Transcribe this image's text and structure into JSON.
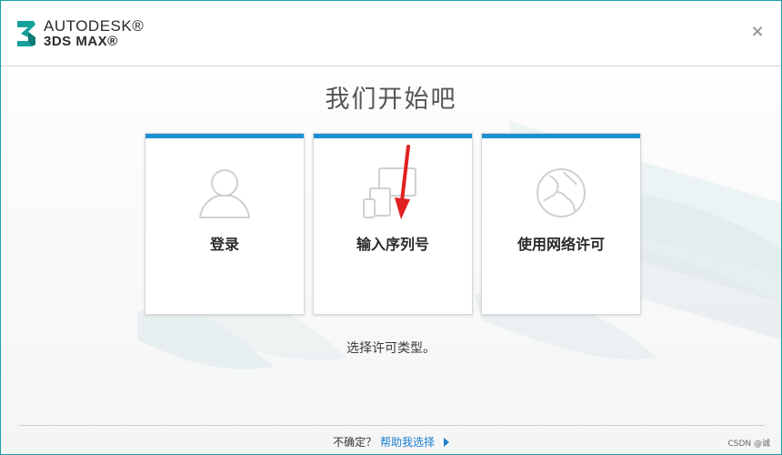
{
  "header": {
    "brand_line1": "AUTODESK®",
    "brand_line2": "3DS MAX®",
    "close_symbol": "×"
  },
  "main": {
    "title": "我们开始吧",
    "cards": [
      {
        "label": "登录",
        "icon": "user-icon"
      },
      {
        "label": "输入序列号",
        "icon": "devices-icon"
      },
      {
        "label": "使用网络许可",
        "icon": "globe-icon"
      }
    ],
    "hint": "选择许可类型。"
  },
  "footer": {
    "question": "不确定？",
    "help_link": "帮助我选择"
  },
  "watermark": "CSDN @诚",
  "colors": {
    "accent": "#1b90d2",
    "link": "#1b7fd0",
    "annotation_arrow": "#e02020"
  }
}
